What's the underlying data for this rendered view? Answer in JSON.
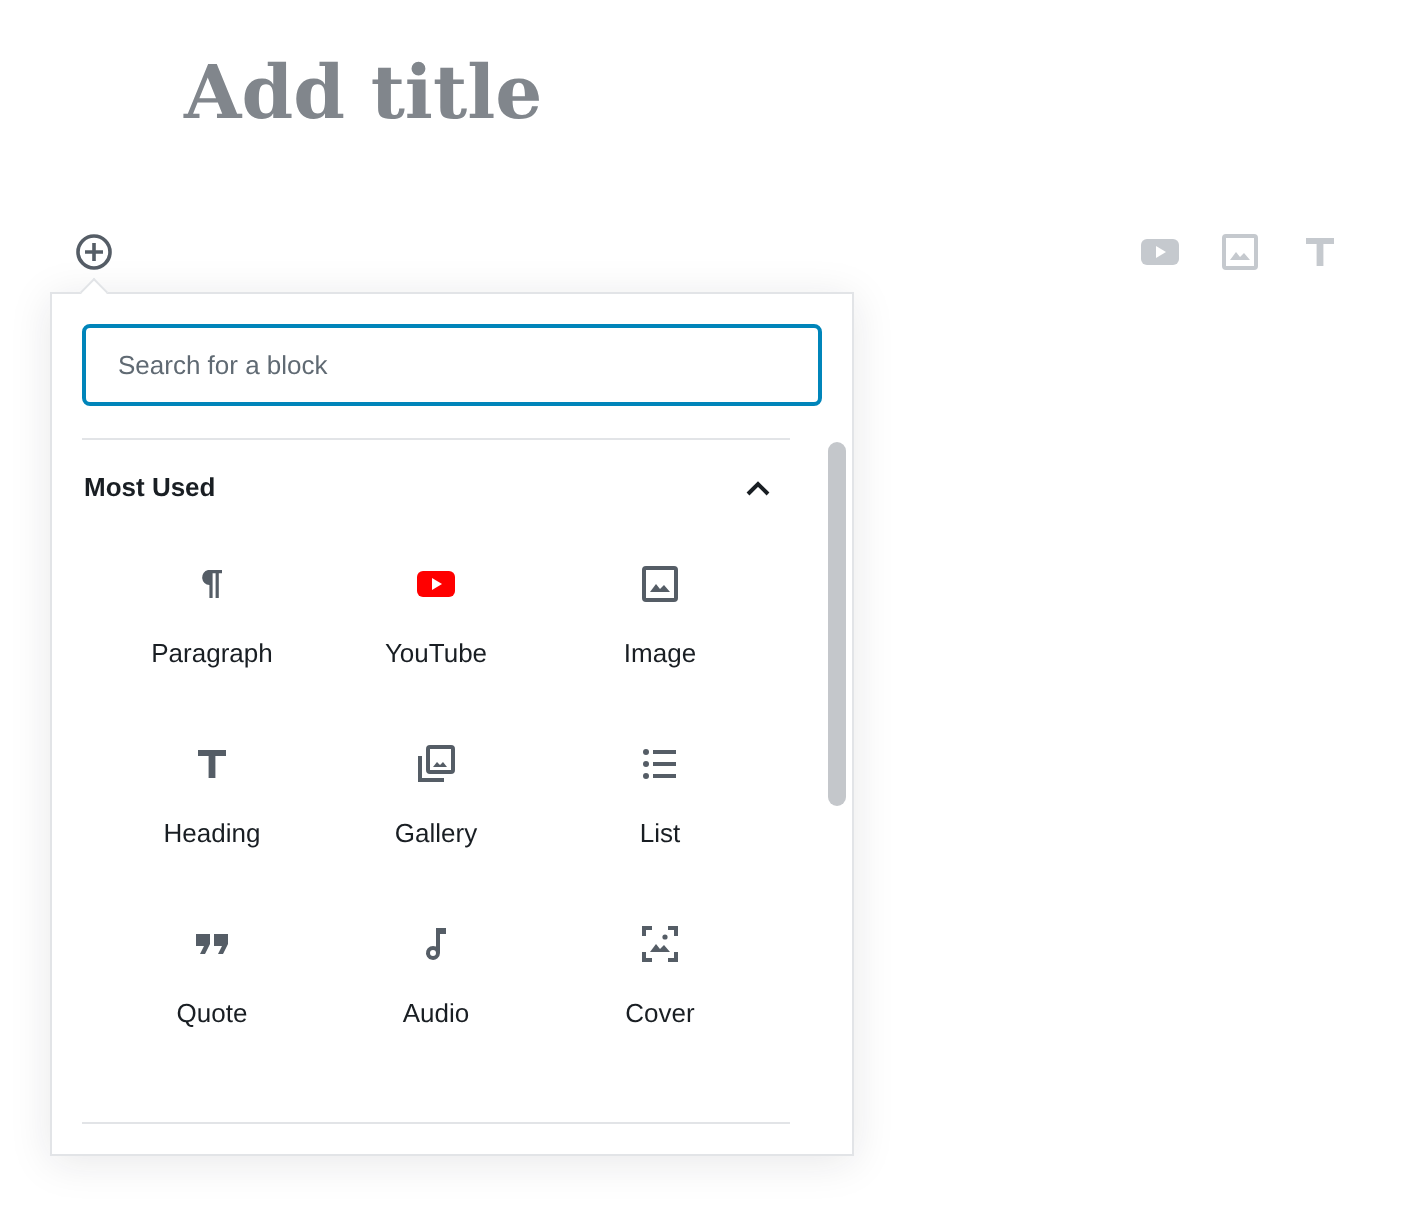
{
  "title_placeholder": "Add title",
  "toolbar": [
    {
      "kind": "youtube"
    },
    {
      "kind": "image"
    },
    {
      "kind": "heading"
    }
  ],
  "inserter": {
    "search": {
      "placeholder": "Search for a block"
    },
    "section": {
      "title": "Most Used",
      "expanded": true,
      "blocks": [
        {
          "label": "Paragraph",
          "kind": "paragraph"
        },
        {
          "label": "YouTube",
          "kind": "youtube"
        },
        {
          "label": "Image",
          "kind": "image"
        },
        {
          "label": "Heading",
          "kind": "heading"
        },
        {
          "label": "Gallery",
          "kind": "gallery"
        },
        {
          "label": "List",
          "kind": "list"
        },
        {
          "label": "Quote",
          "kind": "quote"
        },
        {
          "label": "Audio",
          "kind": "audio"
        },
        {
          "label": "Cover",
          "kind": "cover"
        }
      ]
    }
  }
}
